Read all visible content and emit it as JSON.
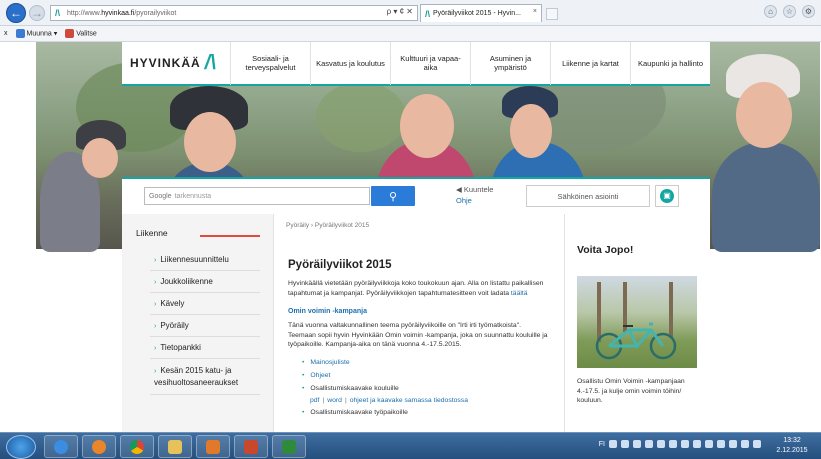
{
  "browser": {
    "url_prefix": "http://www.",
    "url_domain": "hyvinkaa.fi",
    "url_path": "/pyorailyviikot",
    "address_controls": "ρ ▾ ¢ ✕",
    "tab_title": "Pyöräilyviikot 2015 - Hyvin...",
    "tab_close": "×",
    "back_glyph": "←",
    "forward_glyph": "→",
    "window_icons": [
      "⌂",
      "☆",
      "⚙"
    ]
  },
  "command_bar": {
    "close": "x",
    "convert_label": "Muunna",
    "select_label": "Valitse"
  },
  "site": {
    "logo_text": "HYVINKÄÄ",
    "logo_mark": "/\\",
    "nav": [
      "Sosiaali- ja terveyspalvelut",
      "Kasvatus ja koulutus",
      "Kulttuuri ja vapaa-aika",
      "Asuminen ja ympäristö",
      "Liikenne ja kartat",
      "Kaupunki ja hallinto"
    ],
    "search_brand": "Google",
    "search_placeholder": "tarkennusta",
    "search_icon": "search-icon",
    "listen_label": "Kuuntele",
    "help_label": "Ohje",
    "eservice_label": "Sähköinen asiointi"
  },
  "sidenav": {
    "heading": "Liikenne",
    "items": [
      "Liikennesuunnittelu",
      "Joukkoliikenne",
      "Kävely",
      "Pyöräily",
      "Tietopankki",
      "Kesän 2015 katu- ja vesihuoltosaneeraukset"
    ]
  },
  "main": {
    "breadcrumb": "Pyöräily › Pyöräilyviikot 2015",
    "title": "Pyöräilyviikot 2015",
    "intro": "Hyvinkäällä vietetään pyöräilyviikkoja koko toukokuun ajan. Alla on listattu paikallisen tapahtumat ja kampanjat. Pyöräilyviikkojen tapahtumatesitteen voit ladata ",
    "intro_link": "täältä",
    "subheading": "Omin voimin -kampanja",
    "para": "Tänä vuonna valtakunnallinen teema pyöräilyviikoille on \"Irti irti työmatkoista\". Teemaan sopii hyvin Hyvinkään Omin voimin -kampanja, joka on suunnattu kouluille ja työpaikoille. Kampanja-aika on tänä vuonna 4.-17.5.2015.",
    "bullets": [
      "Mainosjuliste",
      "Ohjeet",
      "Osallistumiskaavake kouluille"
    ],
    "sublinks": [
      "pdf",
      "word",
      "ohjeet ja kaavake samassa tiedostossa"
    ],
    "bullet_cut": "Osallistumiskaavake työpaikoille"
  },
  "aside": {
    "heading": "Voita Jopo!",
    "text": "Osallistu Omin Voimin -kampanjaan 4.-17.5. ja kulje omin voimin töihin/ kouluun."
  },
  "taskbar": {
    "tray_lang": "FI",
    "time": "13:32",
    "date": "2.12.2015"
  }
}
